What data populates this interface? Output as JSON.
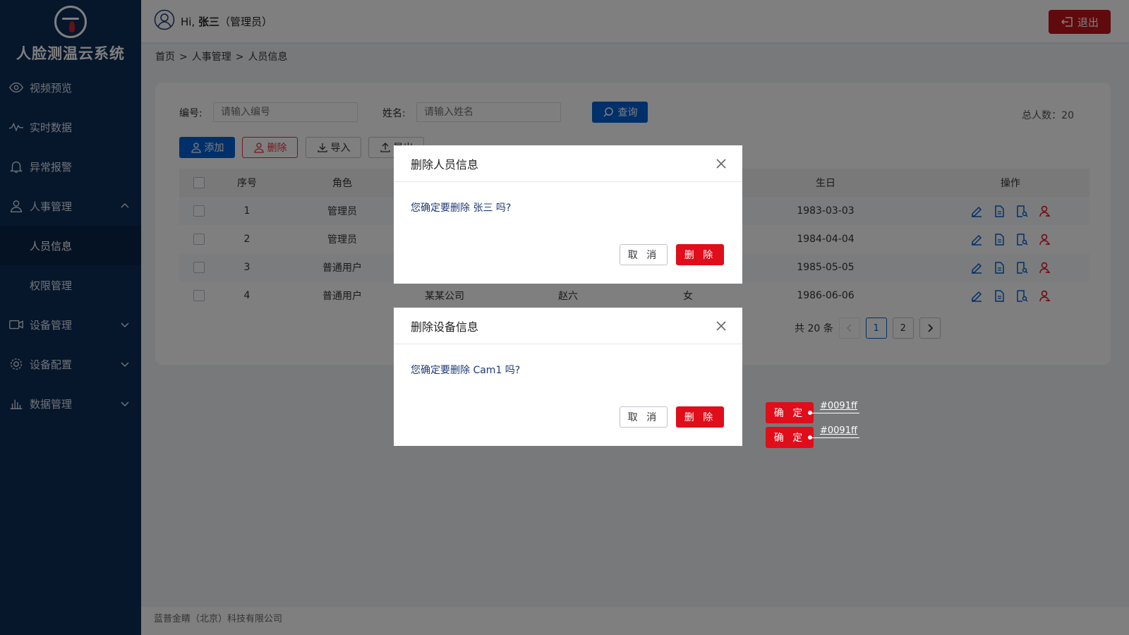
{
  "app": {
    "title": "人脸测温云系统"
  },
  "sidebar": {
    "items": [
      {
        "label": "视频预览"
      },
      {
        "label": "实时数据"
      },
      {
        "label": "异常报警"
      },
      {
        "label": "人事管理"
      },
      {
        "label": "设备管理"
      },
      {
        "label": "设备配置"
      },
      {
        "label": "数据管理"
      }
    ],
    "submenu": [
      {
        "label": "人员信息"
      },
      {
        "label": "权限管理"
      }
    ]
  },
  "header": {
    "greeting_prefix": "Hi, ",
    "user_name": "张三",
    "user_role": "（管理员）",
    "logout_label": "退出"
  },
  "breadcrumb": {
    "home": "首页",
    "sep": ">",
    "section": "人事管理",
    "page": "人员信息"
  },
  "filters": {
    "id_label": "编号:",
    "id_placeholder": "请输入编号",
    "name_label": "姓名:",
    "name_placeholder": "请输入姓名",
    "query_label": "查询",
    "total_text": "总人数：20"
  },
  "toolbar": {
    "add_label": "添加",
    "delete_label": "删除",
    "import_label": "导入",
    "export_label": "导出"
  },
  "table": {
    "headers": {
      "seq": "序号",
      "role": "角色",
      "birthday": "生日",
      "ops": "操作"
    },
    "rows": [
      {
        "seq": "1",
        "role": "管理员",
        "company": "",
        "name": "",
        "sex": "",
        "birthday": "1983-03-03"
      },
      {
        "seq": "2",
        "role": "管理员",
        "company": "",
        "name": "",
        "sex": "",
        "birthday": "1984-04-04"
      },
      {
        "seq": "3",
        "role": "普通用户",
        "company": "",
        "name": "",
        "sex": "",
        "birthday": "1985-05-05"
      },
      {
        "seq": "4",
        "role": "普通用户",
        "company": "某某公司",
        "name": "赵六",
        "sex": "女",
        "birthday": "1986-06-06"
      }
    ]
  },
  "pagination": {
    "total_text": "共 20 条",
    "pages": [
      "1",
      "2"
    ],
    "current": "1"
  },
  "footer": {
    "text": "蓝普金睛（北京）科技有限公司"
  },
  "dialogs": [
    {
      "title": "删除人员信息",
      "message": "您确定要删除 张三 吗?",
      "cancel_label": "取 消",
      "delete_label": "删 除"
    },
    {
      "title": "删除设备信息",
      "message": "您确定要删除 Cam1 吗?",
      "cancel_label": "取 消",
      "delete_label": "删 除"
    }
  ],
  "annotations": [
    {
      "button_label": "确 定",
      "color_label": "#0091ff"
    },
    {
      "button_label": "确 定",
      "color_label": "#0091ff"
    }
  ],
  "colors": {
    "primary": "#0061d4",
    "danger": "#e00d1a",
    "sidebar": "#0d2c57"
  }
}
